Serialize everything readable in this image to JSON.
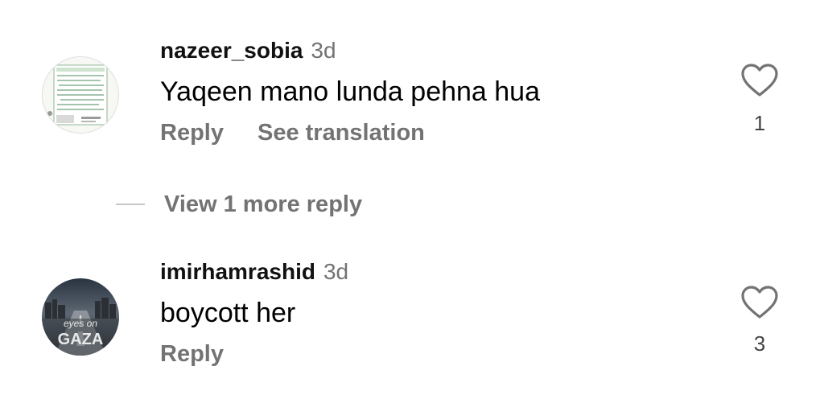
{
  "comments": [
    {
      "username": "nazeer_sobia",
      "time": "3d",
      "text": "Yaqeen mano lunda pehna hua",
      "reply_label": "Reply",
      "translate_label": "See translation",
      "like_count": "1"
    },
    {
      "username": "imirhamrashid",
      "time": "3d",
      "text": "boycott her",
      "reply_label": "Reply",
      "like_count": "3"
    }
  ],
  "more_replies": {
    "label": "View 1 more reply"
  },
  "avatar_texts": {
    "second_top": "eyes on",
    "second_bottom": "GAZA"
  },
  "colors": {
    "muted": "#737373",
    "like_icon": "#737373"
  }
}
